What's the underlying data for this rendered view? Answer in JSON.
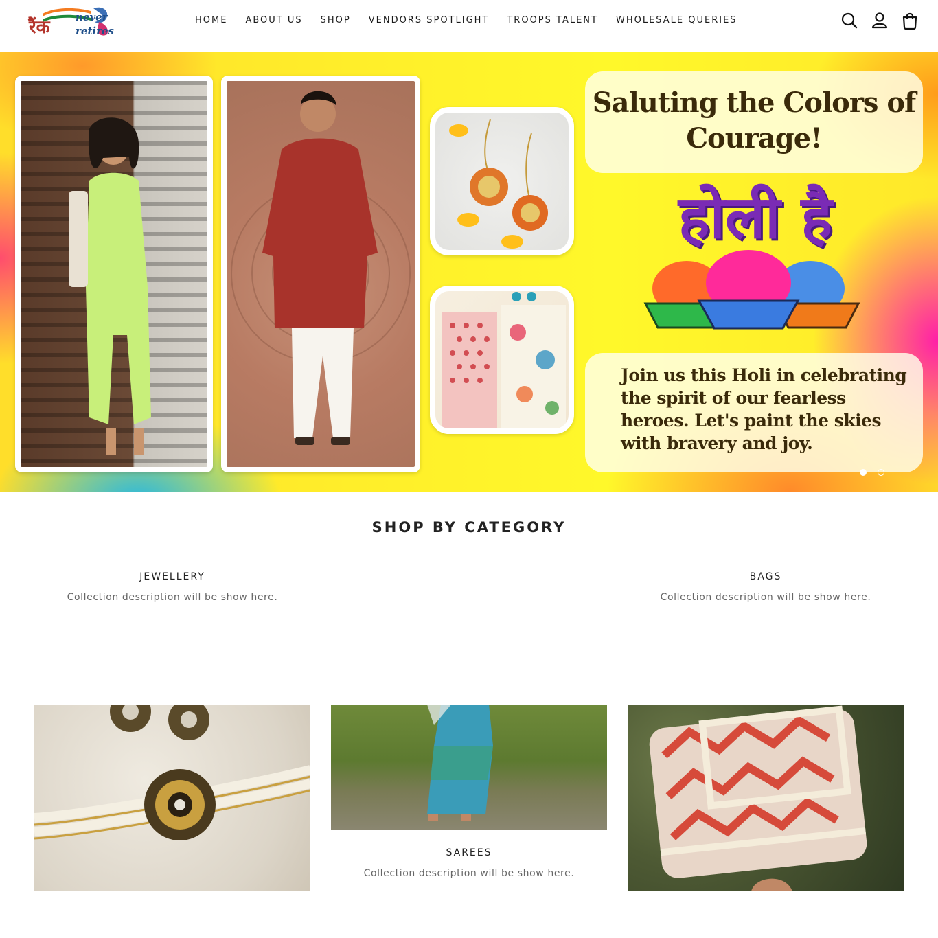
{
  "header": {
    "logo": {
      "devanagari": "रैंक",
      "line1": "never",
      "line2": "retires"
    },
    "nav": [
      {
        "label": "HOME"
      },
      {
        "label": "ABOUT US"
      },
      {
        "label": "SHOP"
      },
      {
        "label": "VENDORS SPOTLIGHT"
      },
      {
        "label": "TROOPS TALENT"
      },
      {
        "label": "WHOLESALE QUERIES"
      }
    ],
    "icons": [
      "search-icon",
      "account-icon",
      "cart-icon"
    ]
  },
  "hero": {
    "headline": "Saluting the Colors of Courage!",
    "holi_text": "होली है",
    "body": "Join us this Holi in celebrating the spirit of our fearless heroes. Let's paint the skies with bravery and joy.",
    "slides": {
      "total": 2,
      "active": 1
    }
  },
  "category_section": {
    "title": "SHOP BY CATEGORY",
    "categories": [
      {
        "name": "JEWELLERY",
        "description": "Collection description will be show here."
      },
      {
        "name": "SAREES",
        "description": "Collection description will be show here."
      },
      {
        "name": "BAGS",
        "description": "Collection description will be show here."
      }
    ]
  },
  "colors": {
    "nav_text": "#1a1a1a",
    "holi_purple": "#7a2bb5",
    "hero_yellow": "#fff12a",
    "description_gray": "#666666"
  }
}
